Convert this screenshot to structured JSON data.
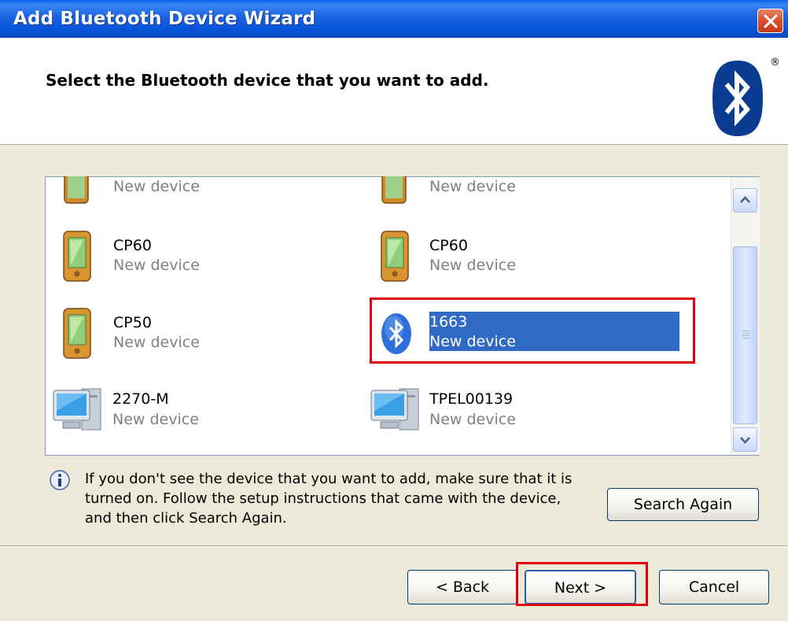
{
  "window": {
    "title": "Add Bluetooth Device Wizard"
  },
  "header": {
    "title": "Select the Bluetooth device that you want to add.",
    "registered_mark": "®"
  },
  "devices": [
    {
      "name": "",
      "status": "New device",
      "icon": "pocket-pc-icon"
    },
    {
      "name": "",
      "status": "New device",
      "icon": "pocket-pc-icon"
    },
    {
      "name": "CP60",
      "status": "New device",
      "icon": "pocket-pc-icon"
    },
    {
      "name": "CP60",
      "status": "New device",
      "icon": "pocket-pc-icon"
    },
    {
      "name": "CP50",
      "status": "New device",
      "icon": "pocket-pc-icon"
    },
    {
      "name": "1663",
      "status": "New device",
      "icon": "bluetooth-icon",
      "selected": true
    },
    {
      "name": "2270-M",
      "status": "New device",
      "icon": "computer-icon"
    },
    {
      "name": "TPEL00139",
      "status": "New device",
      "icon": "computer-icon"
    }
  ],
  "info": {
    "line1": "If you don't see the device that you want to add, make sure that it is",
    "line2": "turned on. Follow the setup instructions that came with the device,",
    "line3": "and then click Search Again."
  },
  "buttons": {
    "search_again": "Search Again",
    "back": "< Back",
    "next": "Next >",
    "cancel": "Cancel"
  },
  "colors": {
    "titlebar": "#0a5ee6",
    "selection": "#316ac5",
    "highlight": "#e0000b",
    "dialog_bg": "#ece9d8"
  }
}
